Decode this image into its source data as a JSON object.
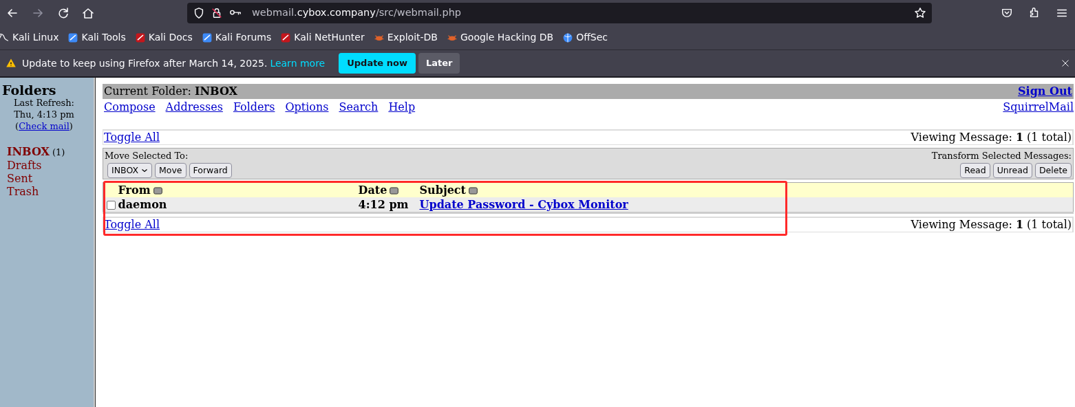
{
  "browser": {
    "url": {
      "prefix": "webmail.",
      "host": "cybox.company",
      "path": "/src/webmail.php"
    },
    "bookmarks": [
      "Kali Linux",
      "Kali Tools",
      "Kali Docs",
      "Kali Forums",
      "Kali NetHunter",
      "Exploit-DB",
      "Google Hacking DB",
      "OffSec"
    ],
    "notification": {
      "message": "Update to keep using Firefox after March 14, 2025.",
      "link": "Learn more",
      "primary_button": "Update now",
      "secondary_button": "Later"
    }
  },
  "sidebar": {
    "title": "Folders",
    "refresh_label": "Last Refresh:",
    "refresh_time": "Thu, 4:13 pm",
    "check_mail": {
      "before": "(",
      "link": "Check mail",
      "after": ")"
    },
    "folders": [
      {
        "name": "INBOX",
        "count": "(1)",
        "selected": true
      },
      {
        "name": "Drafts",
        "selected": false
      },
      {
        "name": "Sent",
        "selected": false
      },
      {
        "name": "Trash",
        "selected": false
      }
    ]
  },
  "main": {
    "current_folder_label": "Current Folder:",
    "current_folder": "INBOX",
    "sign_out": "Sign Out",
    "menu": [
      "Compose",
      "Addresses",
      "Folders",
      "Options",
      "Search",
      "Help"
    ],
    "brand_link": "SquirrelMail",
    "toggle_all_top": "Toggle All",
    "viewing_top": "Viewing Message: **1** (1 total)",
    "move_label": "Move Selected To:",
    "move_select": "INBOX",
    "move_buttons": [
      "Move",
      "Forward"
    ],
    "transform_label": "Transform Selected Messages:",
    "transform_buttons": [
      "Read",
      "Unread",
      "Delete"
    ],
    "table": {
      "columns": [
        "From",
        "Date",
        "Subject"
      ],
      "rows": [
        {
          "from": "daemon",
          "date": "4:12 pm",
          "subject": "Update Password - Cybox Monitor",
          "checked": false
        }
      ]
    },
    "toggle_all_bottom": "Toggle All",
    "viewing_bottom": "Viewing Message: **1** (1 total)"
  }
}
